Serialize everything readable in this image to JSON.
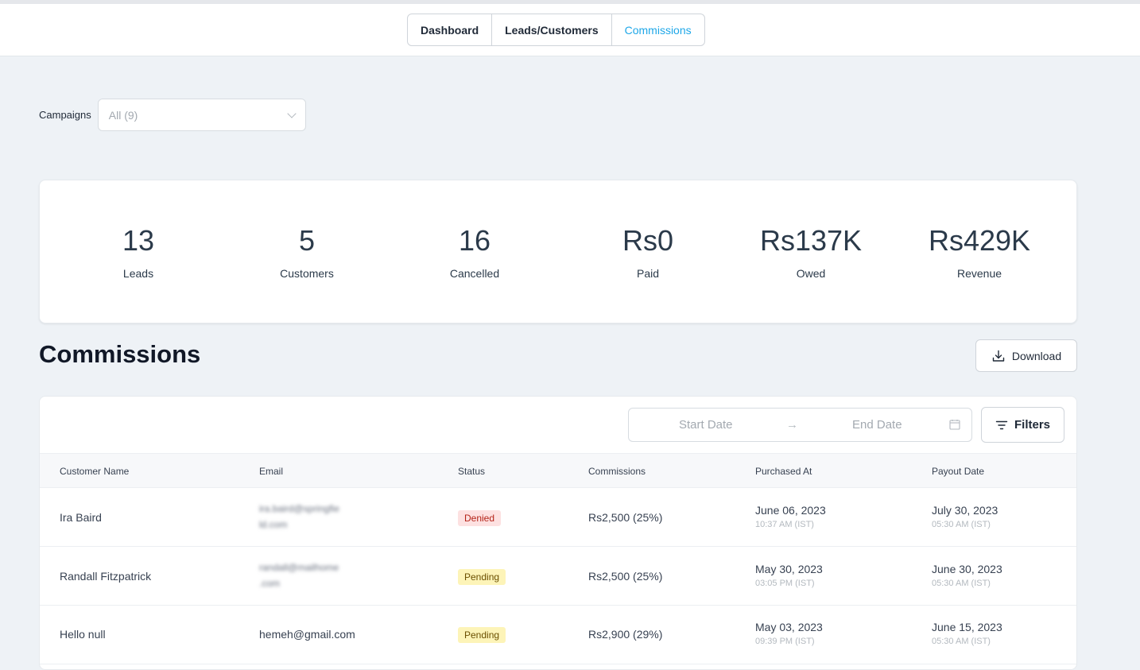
{
  "nav": {
    "tabs": [
      {
        "label": "Dashboard"
      },
      {
        "label": "Leads/Customers"
      },
      {
        "label": "Commissions",
        "active": true
      }
    ]
  },
  "filters": {
    "campaigns_label": "Campaigns",
    "campaigns_value": "All (9)"
  },
  "stats": [
    {
      "value": "13",
      "label": "Leads"
    },
    {
      "value": "5",
      "label": "Customers"
    },
    {
      "value": "16",
      "label": "Cancelled"
    },
    {
      "value": "Rs0",
      "label": "Paid"
    },
    {
      "value": "Rs137K",
      "label": "Owed"
    },
    {
      "value": "Rs429K",
      "label": "Revenue"
    }
  ],
  "section": {
    "title": "Commissions",
    "download_label": "Download"
  },
  "table": {
    "start_placeholder": "Start Date",
    "end_placeholder": "End Date",
    "arrow": "→",
    "filters_label": "Filters",
    "columns": [
      "Customer Name",
      "Email",
      "Status",
      "Commissions",
      "Purchased At",
      "Payout Date"
    ],
    "rows": [
      {
        "name": "Ira Baird",
        "email_line1": "ira.baird@springfie",
        "email_line2": "ld.com",
        "status": "Denied",
        "commission": "Rs2,500 (25%)",
        "purchased_date": "June 06, 2023",
        "purchased_time": "10:37 AM (IST)",
        "payout_date": "July 30, 2023",
        "payout_time": "05:30 AM (IST)"
      },
      {
        "name": "Randall Fitzpatrick",
        "email_line1": "randall@mailhome",
        "email_line2": ".com",
        "status": "Pending",
        "commission": "Rs2,500 (25%)",
        "purchased_date": "May 30, 2023",
        "purchased_time": "03:05 PM (IST)",
        "payout_date": "June 30, 2023",
        "payout_time": "05:30 AM (IST)"
      },
      {
        "name": "Hello null",
        "email": "hemeh@gmail.com",
        "status": "Pending",
        "commission": "Rs2,900 (29%)",
        "purchased_date": "May 03, 2023",
        "purchased_time": "09:39 PM (IST)",
        "payout_date": "June 15, 2023",
        "payout_time": "05:30 AM (IST)"
      }
    ]
  },
  "colors": {
    "accent": "#1ea7e8",
    "page_bg": "#eef2f6",
    "denied_bg": "#fde1e1",
    "pending_bg": "#fdf4b8"
  }
}
